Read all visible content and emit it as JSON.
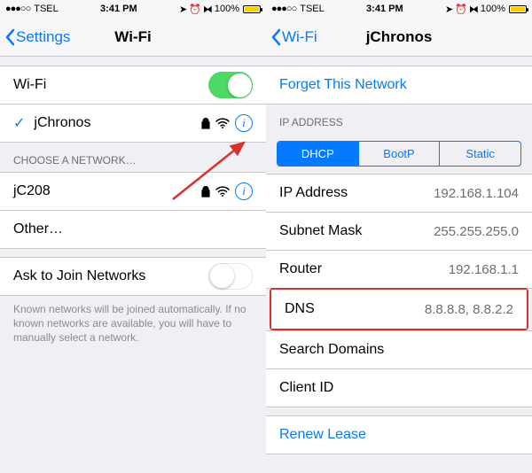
{
  "left": {
    "status": {
      "carrier": "TSEL",
      "time": "3:41 PM",
      "battery": "100%"
    },
    "nav": {
      "back": "Settings",
      "title": "Wi-Fi"
    },
    "wifi_row_label": "Wi-Fi",
    "connected": {
      "name": "jChronos"
    },
    "choose_header": "CHOOSE A NETWORK…",
    "networks": [
      {
        "name": "jC208"
      }
    ],
    "other_label": "Other…",
    "ask_join_label": "Ask to Join Networks",
    "footer": "Known networks will be joined automatically. If no known networks are available, you will have to manually select a network."
  },
  "right": {
    "status": {
      "carrier": "TSEL",
      "time": "3:41 PM",
      "battery": "100%"
    },
    "nav": {
      "back": "Wi-Fi",
      "title": "jChronos"
    },
    "forget_label": "Forget This Network",
    "ip_header": "IP ADDRESS",
    "tabs": {
      "dhcp": "DHCP",
      "bootp": "BootP",
      "static": "Static"
    },
    "fields": {
      "ip_label": "IP Address",
      "ip_value": "192.168.1.104",
      "subnet_label": "Subnet Mask",
      "subnet_value": "255.255.255.0",
      "router_label": "Router",
      "router_value": "192.168.1.1",
      "dns_label": "DNS",
      "dns_value": "8.8.8.8, 8.8.2.2",
      "search_label": "Search Domains",
      "client_label": "Client ID"
    },
    "renew_label": "Renew Lease"
  }
}
